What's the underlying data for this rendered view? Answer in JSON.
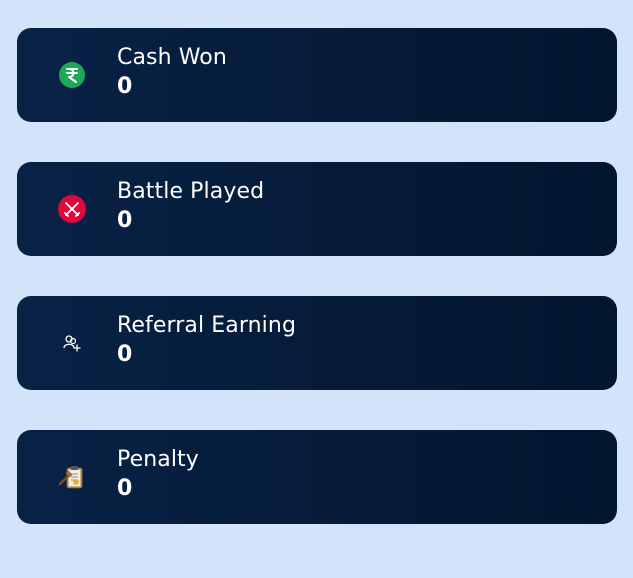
{
  "stats": [
    {
      "label": "Cash Won",
      "value": "0",
      "icon": "rupee-coin-icon"
    },
    {
      "label": "Battle Played",
      "value": "0",
      "icon": "crossed-swords-icon"
    },
    {
      "label": "Referral Earning",
      "value": "0",
      "icon": "users-add-icon"
    },
    {
      "label": "Penalty",
      "value": "0",
      "icon": "clipboard-gavel-icon"
    }
  ],
  "colors": {
    "page_background": "#d3e3fa",
    "card_background": "#06203f",
    "text": "#ffffff",
    "cash_icon": "#1fa855",
    "battle_icon": "#e0093e"
  }
}
